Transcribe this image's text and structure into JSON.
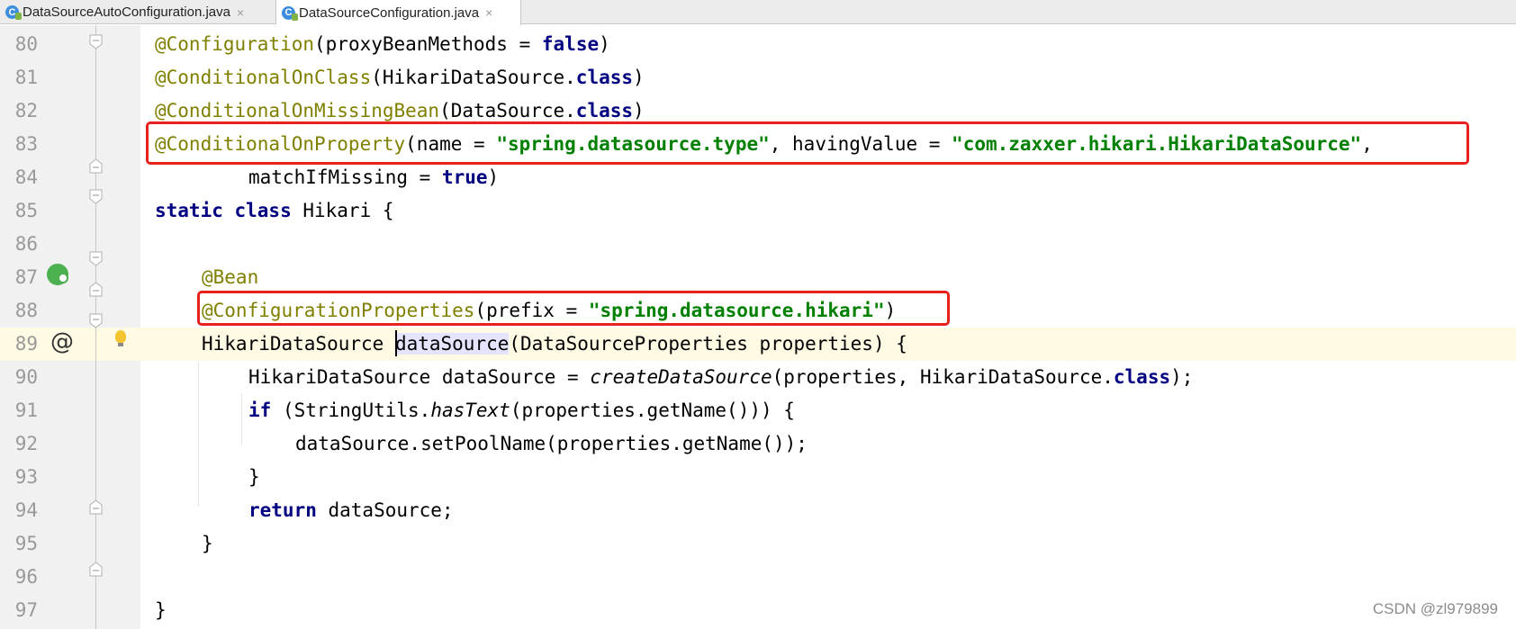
{
  "tabs": [
    {
      "label": "DataSourceAutoConfiguration.java",
      "icon": "java-class-icon",
      "close": "×"
    },
    {
      "label": "DataSourceConfiguration.java",
      "icon": "java-class-icon",
      "close": "×"
    }
  ],
  "line_numbers": [
    "80",
    "81",
    "82",
    "83",
    "84",
    "85",
    "86",
    "87",
    "88",
    "89",
    "90",
    "91",
    "92",
    "93",
    "94",
    "95",
    "96",
    "97"
  ],
  "code": {
    "l80": {
      "a": "@Configuration",
      "b": "(proxyBeanMethods = ",
      "c": "false",
      "d": ")"
    },
    "l81": {
      "a": "@ConditionalOnClass",
      "b": "(HikariDataSource.",
      "c": "class",
      "d": ")"
    },
    "l82": {
      "a": "@ConditionalOnMissingBean",
      "b": "(DataSource.",
      "c": "class",
      "d": ")"
    },
    "l83": {
      "a": "@ConditionalOnProperty",
      "b": "(name = ",
      "c": "\"spring.datasource.type\"",
      "d": ", havingValue = ",
      "e": "\"com.zaxxer.hikari.HikariDataSource\"",
      "f": ","
    },
    "l84": {
      "a": "matchIfMissing = ",
      "b": "true",
      "c": ")"
    },
    "l85": {
      "a": "static class",
      "b": " Hikari {"
    },
    "l87": {
      "a": "@Bean"
    },
    "l88": {
      "a": "@ConfigurationProperties",
      "b": "(prefix = ",
      "c": "\"spring.datasource.hikari\"",
      "d": ")"
    },
    "l89": {
      "a": "HikariDataSource ",
      "b": "dataSource",
      "c": "(DataSourceProperties properties) {"
    },
    "l90": {
      "a": "HikariDataSource dataSource = ",
      "b": "createDataSource",
      "c": "(properties, HikariDataSource.",
      "d": "class",
      "e": ");"
    },
    "l91": {
      "a": "if",
      "b": " (StringUtils.",
      "c": "hasText",
      "d": "(properties.getName())) {"
    },
    "l92": {
      "a": "dataSource.setPoolName(properties.getName());"
    },
    "l93": {
      "a": "}"
    },
    "l94": {
      "a": "return",
      "b": " dataSource;"
    },
    "l95": {
      "a": "}"
    },
    "l97": {
      "a": "}"
    }
  },
  "gutter_icons": {
    "at_symbol": "@",
    "bean": "spring-bean-icon",
    "bulb": "intention-bulb-icon"
  },
  "watermark": "CSDN @zl979899",
  "colors": {
    "annotation": "#808000",
    "keyword": "#000080",
    "string": "#008000",
    "highlight_box": "#e8211f",
    "current_line": "#fffae3"
  }
}
